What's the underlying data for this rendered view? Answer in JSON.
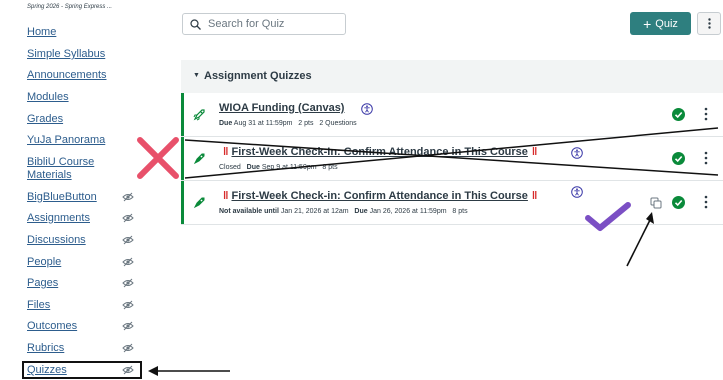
{
  "sidebar": {
    "term": "Spring 2026 - Spring Express ...",
    "items": [
      {
        "label": "Home",
        "hidden": false
      },
      {
        "label": "Simple Syllabus",
        "hidden": false
      },
      {
        "label": "Announcements",
        "hidden": false
      },
      {
        "label": "Modules",
        "hidden": false
      },
      {
        "label": "Grades",
        "hidden": false
      },
      {
        "label": "YuJa Panorama",
        "hidden": false
      },
      {
        "label": "BibliU Course Materials",
        "hidden": false
      },
      {
        "label": "BigBlueButton",
        "hidden": true
      },
      {
        "label": "Assignments",
        "hidden": true
      },
      {
        "label": "Discussions",
        "hidden": true
      },
      {
        "label": "People",
        "hidden": true
      },
      {
        "label": "Pages",
        "hidden": true
      },
      {
        "label": "Files",
        "hidden": true
      },
      {
        "label": "Outcomes",
        "hidden": true
      },
      {
        "label": "Rubrics",
        "hidden": true
      },
      {
        "label": "Quizzes",
        "hidden": true
      }
    ]
  },
  "toolbar": {
    "search_placeholder": "Search for Quiz",
    "add_quiz_label": "Quiz",
    "more_icon": "kebab-icon"
  },
  "group": {
    "title": "Assignment Quizzes"
  },
  "quizzes": [
    {
      "title": "WIOA Funding (Canvas)",
      "status": "",
      "due_label": "Due",
      "due": "Aug 31 at 11:59pm",
      "points": "2 pts",
      "questions": "2 Questions"
    },
    {
      "title": "First-Week Check-In: Confirm Attendance in This Course",
      "status": "Closed",
      "due_label": "Due",
      "due": "Sep 9 at 11:59pm",
      "points": "8 pts"
    },
    {
      "title": "First-Week Check-in: Confirm Attendance in This Course",
      "status_label": "Not available until",
      "status": "Jan 21, 2026 at 12am",
      "due_label": "Due",
      "due": "Jan 26, 2026 at 11:59pm",
      "points": "8 pts"
    }
  ],
  "colors": {
    "accent": "#2e7f7f",
    "link": "#2d5d8d",
    "published": "#0a8a3a",
    "pin": "#d72a2a",
    "x_mark": "#e8506a",
    "checkmark": "#7b4fc4"
  }
}
